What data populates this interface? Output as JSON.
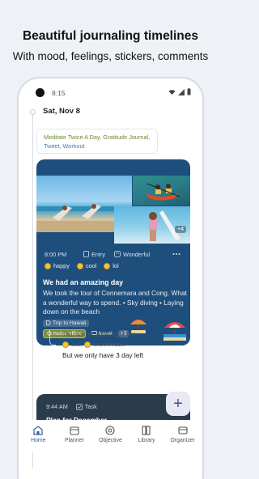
{
  "promo": {
    "headline": "Beautiful journaling timelines",
    "subline": "With mood, feelings, stickers, comments"
  },
  "statusbar": {
    "time": "8:15"
  },
  "timeline": {
    "date": "Sat, Nov 8",
    "habits": {
      "done": "Meditate Twice A Day",
      "separator1": ",",
      "item2": "Gratitude Journal",
      "separator2": ",",
      "item3": "Tweet",
      "separator3": ",",
      "item4": "Workout"
    }
  },
  "entry": {
    "more_photos": "+4",
    "time": "8:00 PM",
    "type": "Entry",
    "mood_label": "Wonderful",
    "more_icon": "more-horizontal-icon",
    "feelings": [
      {
        "label": "happy"
      },
      {
        "label": "cool"
      },
      {
        "label": "lol"
      }
    ],
    "title": "We had an amazing day",
    "body": "We took the tour of Connemara and Cong. What a wonderful way to spend.   • Sky diving   • Laying down on the beach",
    "tags": {
      "trip": "Trip to Hawaii",
      "office": "home office",
      "travel": "travel",
      "extra_count": "+2"
    }
  },
  "comment": {
    "time": "Thu, Nov 14, 2019 - 8:15 PM",
    "mood1": "sad,",
    "mood2": "unbelievable",
    "text": "But we only have 3 day left"
  },
  "task": {
    "time": "9:44 AM",
    "type": "Task",
    "title": "Plan for December"
  },
  "fab": {
    "label": "+"
  },
  "bottom_nav": {
    "home": "Home",
    "planner": "Planner",
    "objective": "Objective",
    "library": "Library",
    "organizer": "Organizer"
  },
  "colors": {
    "accent": "#3b5d93",
    "entry_card": "#1e4e7c",
    "task_card": "#2a3b4c",
    "habit_done": "#6c8a2d",
    "habit_link": "#3b78b5"
  }
}
